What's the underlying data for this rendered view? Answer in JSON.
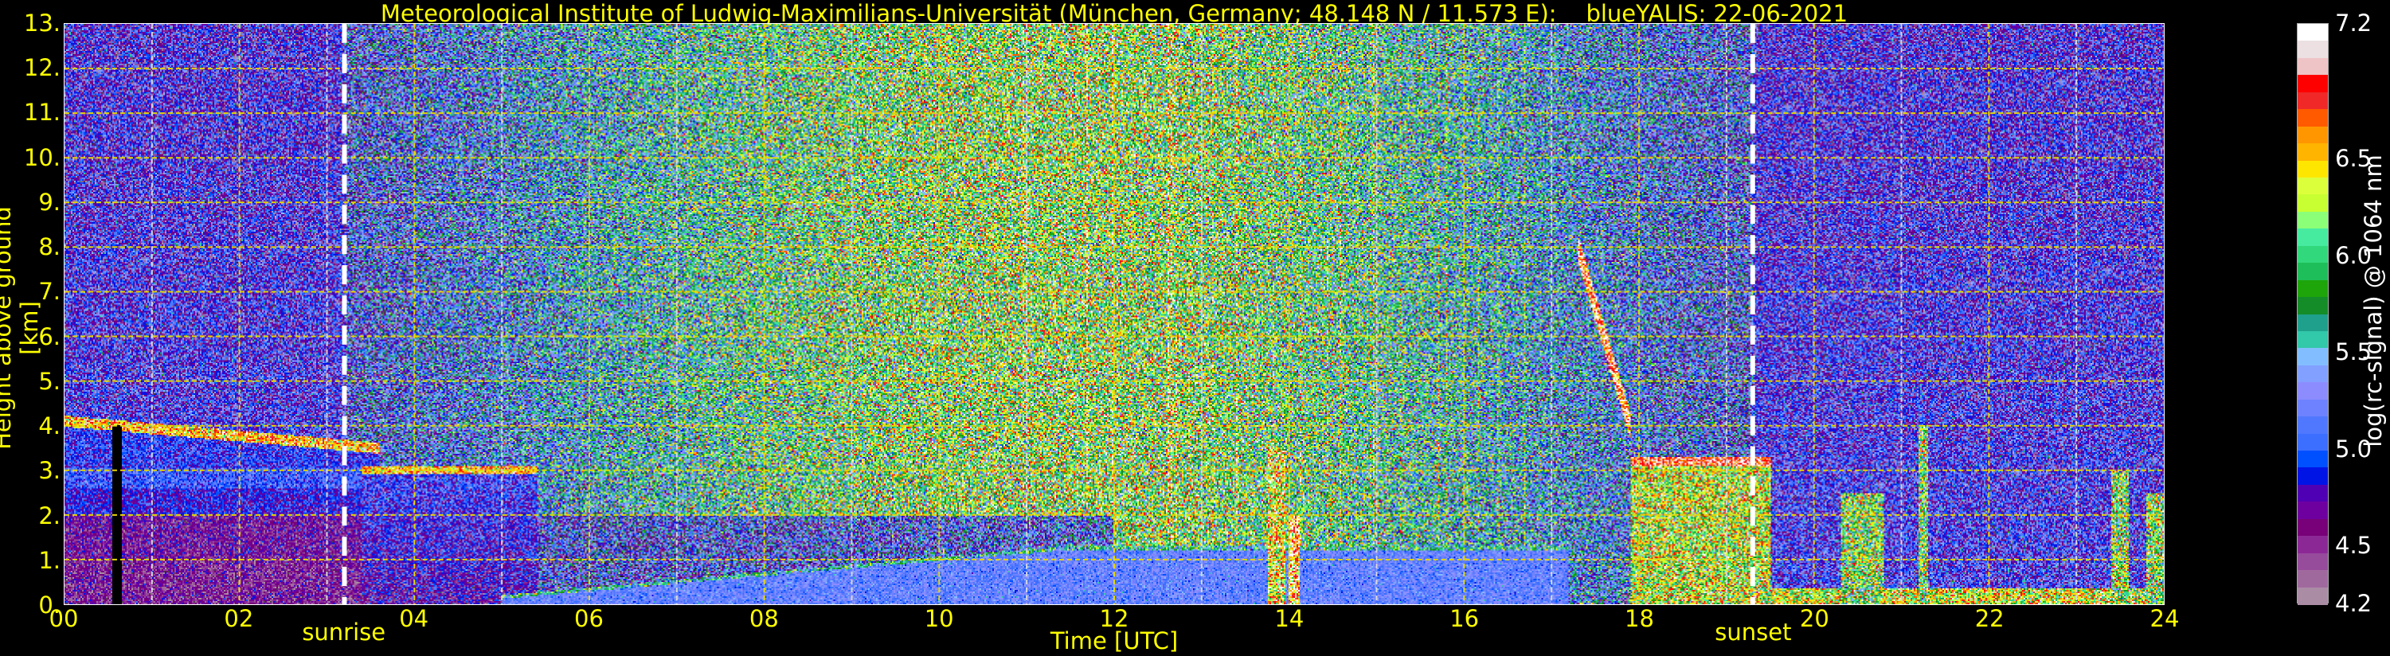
{
  "chart_data": {
    "type": "heatmap",
    "title": "Meteorological Institute of Ludwig-Maximilians-Universität (München, Germany; 48.148 N / 11.573 E):    blueYALIS: 22-06-2021",
    "xlabel": "Time [UTC]",
    "ylabel": "Height above ground [km]",
    "xlim": [
      0,
      24
    ],
    "ylim": [
      0,
      13
    ],
    "x_ticks": [
      "00",
      "02",
      "04",
      "06",
      "08",
      "10",
      "12",
      "14",
      "16",
      "18",
      "20",
      "22",
      "24"
    ],
    "y_ticks": [
      "0.",
      "1.",
      "2.",
      "3.",
      "4.",
      "5.",
      "6.",
      "7.",
      "8.",
      "9.",
      "10.",
      "11.",
      "12.",
      "13."
    ],
    "grid": true,
    "annotations": [
      {
        "label": "sunrise",
        "time": 3.2
      },
      {
        "label": "sunset",
        "time": 19.3
      }
    ],
    "colorbar": {
      "label": "log(rc-signal) @ 1064 nm",
      "range": [
        4.2,
        7.2
      ],
      "ticks": [
        "4.2",
        "4.5",
        "5.0",
        "5.5",
        "6.0",
        "6.5",
        "7.2"
      ],
      "colors": [
        "#ffffff",
        "#ece0e3",
        "#efc4c6",
        "#ff0000",
        "#f02828",
        "#ff5a00",
        "#ff9600",
        "#ffb400",
        "#ffe600",
        "#dcff3c",
        "#c8ff32",
        "#8cff78",
        "#46eba0",
        "#32d87c",
        "#1ebe5a",
        "#1ea50a",
        "#148c28",
        "#1ea08c",
        "#32c8aa",
        "#82beff",
        "#82a0ff",
        "#8c8cff",
        "#6e82ff",
        "#5078ff",
        "#3c6eff",
        "#0050ff",
        "#0014e6",
        "#5000b4",
        "#6e00a0",
        "#780078",
        "#8c2896",
        "#964b9b",
        "#a0699e",
        "#aa8ca5"
      ]
    },
    "features": [
      {
        "name": "residual layer top",
        "time": [
          0,
          3.5
        ],
        "height_km": [
          4.1,
          3.5
        ]
      },
      {
        "name": "elevated layer",
        "time": [
          3.5,
          5.3
        ],
        "height_km": 3.0
      },
      {
        "name": "boundary layer top",
        "time": [
          5,
          17
        ],
        "height_km": [
          0.2,
          1.3
        ]
      },
      {
        "name": "low cloud",
        "time": [
          13.75,
          14.1
        ],
        "height_km": [
          0,
          3.5
        ]
      },
      {
        "name": "descending cloud",
        "time": [
          17.3,
          17.9
        ],
        "height_km": [
          8,
          4
        ]
      },
      {
        "name": "cloud layer",
        "time": [
          17.9,
          19.5
        ],
        "height_km": 3.3
      },
      {
        "name": "low clouds",
        "time": [
          19.5,
          24
        ],
        "height_km": [
          0.3,
          3
        ]
      }
    ]
  }
}
